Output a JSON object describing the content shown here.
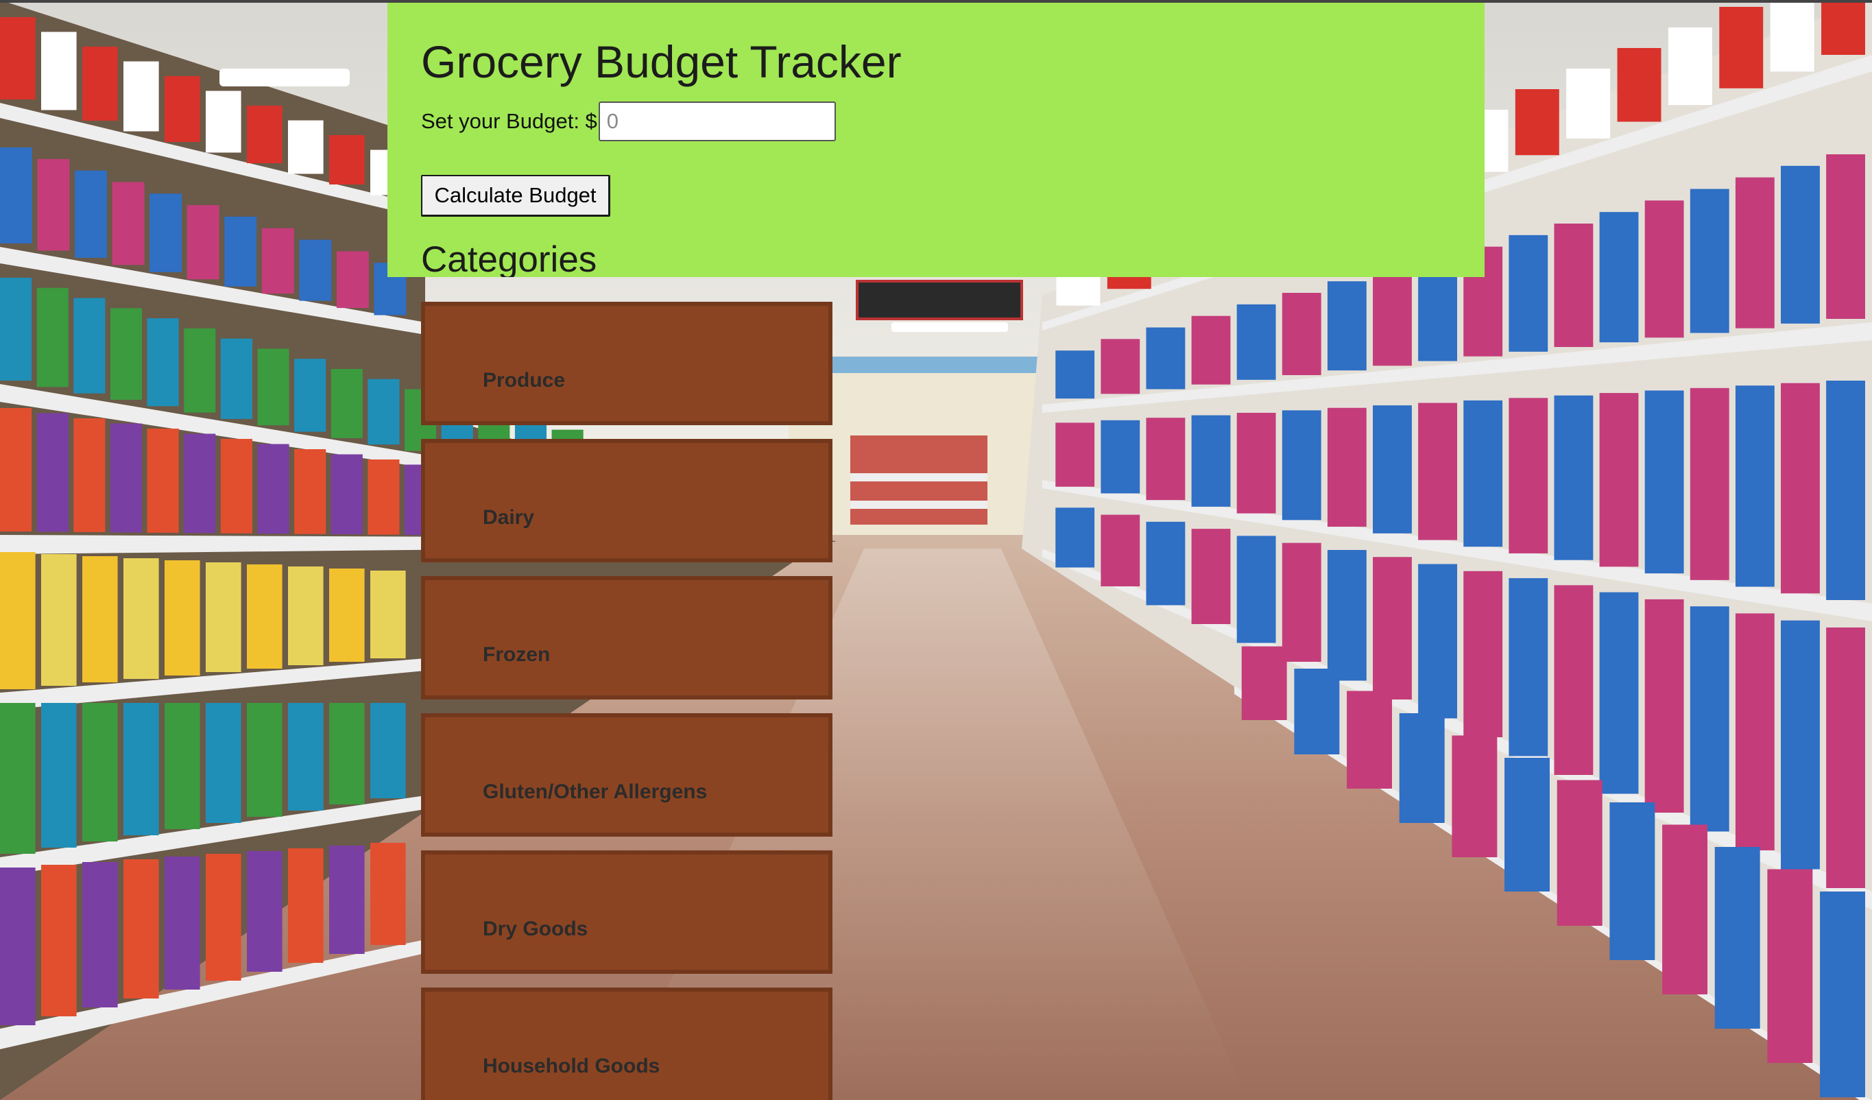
{
  "app": {
    "title": "Grocery Budget Tracker"
  },
  "budget": {
    "label": "Set your Budget: $",
    "value": "",
    "placeholder": "0"
  },
  "actions": {
    "calculate_label": "Calculate Budget"
  },
  "categories": {
    "heading": "Categories",
    "items": [
      {
        "label": "Produce"
      },
      {
        "label": "Dairy"
      },
      {
        "label": "Frozen"
      },
      {
        "label": "Gluten/Other Allergens"
      },
      {
        "label": "Dry Goods"
      },
      {
        "label": "Household Goods"
      }
    ]
  },
  "colors": {
    "header_panel": "#a1e854",
    "category_card": "#8b4422",
    "category_card_border": "#73381c",
    "category_text": "#2b2b2b",
    "title_text": "#1c1c1c"
  }
}
